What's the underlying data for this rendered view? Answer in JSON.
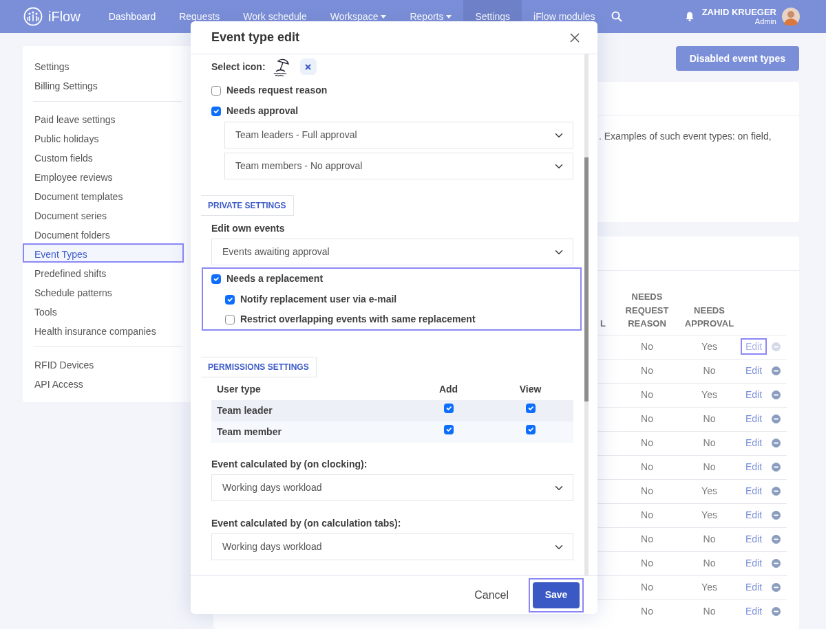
{
  "navbar": {
    "brand": "iFlow",
    "items": [
      {
        "label": "Dashboard",
        "selected": false,
        "dropdown": false
      },
      {
        "label": "Requests",
        "selected": false,
        "dropdown": false
      },
      {
        "label": "Work schedule",
        "selected": false,
        "dropdown": false
      },
      {
        "label": "Workspace",
        "selected": false,
        "dropdown": true
      },
      {
        "label": "Reports",
        "selected": false,
        "dropdown": true
      },
      {
        "label": "Settings",
        "selected": true,
        "dropdown": false
      },
      {
        "label": "iFlow modules",
        "selected": false,
        "dropdown": false
      }
    ],
    "user": {
      "name": "ZAHID KRUEGER",
      "role": "Admin"
    }
  },
  "sidebar": {
    "groups": [
      [
        {
          "label": "Settings",
          "selected": false
        },
        {
          "label": "Billing Settings",
          "selected": false
        }
      ],
      [
        {
          "label": "Paid leave settings",
          "selected": false
        },
        {
          "label": "Public holidays",
          "selected": false
        },
        {
          "label": "Custom fields",
          "selected": false
        },
        {
          "label": "Employee reviews",
          "selected": false
        },
        {
          "label": "Document templates",
          "selected": false
        },
        {
          "label": "Document series",
          "selected": false
        },
        {
          "label": "Document folders",
          "selected": false
        },
        {
          "label": "Event Types",
          "selected": true
        },
        {
          "label": "Predefined shifts",
          "selected": false
        },
        {
          "label": "Schedule patterns",
          "selected": false
        },
        {
          "label": "Tools",
          "selected": false
        },
        {
          "label": "Health insurance companies",
          "selected": false
        }
      ],
      [
        {
          "label": "RFID Devices",
          "selected": false
        },
        {
          "label": "API Access",
          "selected": false
        }
      ]
    ]
  },
  "disabled_button": "Disabled event types",
  "info_card": {
    "text": ". Examples of such event types: on field,"
  },
  "table": {
    "columns": [
      "L",
      "NEEDS REQUEST REASON",
      "NEEDS APPROVAL"
    ],
    "rows": [
      {
        "reason": "No",
        "approval": "Yes",
        "edit": "Edit",
        "highlighted": true,
        "remove_disabled": true
      },
      {
        "reason": "No",
        "approval": "No",
        "edit": "Edit",
        "highlighted": false,
        "remove_disabled": false
      },
      {
        "reason": "No",
        "approval": "Yes",
        "edit": "Edit",
        "highlighted": false,
        "remove_disabled": false
      },
      {
        "reason": "No",
        "approval": "No",
        "edit": "Edit",
        "highlighted": false,
        "remove_disabled": false
      },
      {
        "reason": "No",
        "approval": "No",
        "edit": "Edit",
        "highlighted": false,
        "remove_disabled": false
      },
      {
        "reason": "No",
        "approval": "No",
        "edit": "Edit",
        "highlighted": false,
        "remove_disabled": false
      },
      {
        "reason": "No",
        "approval": "Yes",
        "edit": "Edit",
        "highlighted": false,
        "remove_disabled": false
      },
      {
        "reason": "No",
        "approval": "Yes",
        "edit": "Edit",
        "highlighted": false,
        "remove_disabled": false
      },
      {
        "reason": "No",
        "approval": "No",
        "edit": "Edit",
        "highlighted": false,
        "remove_disabled": false
      },
      {
        "reason": "No",
        "approval": "No",
        "edit": "Edit",
        "highlighted": false,
        "remove_disabled": false
      },
      {
        "reason": "No",
        "approval": "Yes",
        "edit": "Edit",
        "highlighted": false,
        "remove_disabled": false
      },
      {
        "reason": "No",
        "approval": "No",
        "edit": "Edit",
        "highlighted": false,
        "remove_disabled": false
      }
    ]
  },
  "modal": {
    "title": "Event type edit",
    "select_icon_label": "Select icon:",
    "checks": [
      {
        "label": "Needs request reason",
        "checked": false
      },
      {
        "label": "Needs approval",
        "checked": true
      }
    ],
    "approval_selects": [
      "Team leaders - Full approval",
      "Team members - No approval"
    ],
    "private_tab": "PRIVATE SETTINGS",
    "edit_own_label": "Edit own events",
    "edit_own_value": "Events awaiting approval",
    "replacement": {
      "highlighted": true,
      "label": "Needs a replacement",
      "checked": true,
      "children": [
        {
          "label": "Notify replacement user via e-mail",
          "checked": true
        },
        {
          "label": "Restrict overlapping events with same replacement",
          "checked": false
        }
      ]
    },
    "permissions_tab": "PERMISSIONS SETTINGS",
    "permissions": {
      "columns": [
        "User type",
        "Add",
        "View"
      ],
      "rows": [
        {
          "user_type": "Team leader",
          "add": true,
          "view": true
        },
        {
          "user_type": "Team member",
          "add": true,
          "view": true
        }
      ]
    },
    "calc": [
      {
        "label": "Event calculated by (on clocking):",
        "value": "Working days workload"
      },
      {
        "label": "Event calculated by (on calculation tabs):",
        "value": "Working days workload"
      }
    ],
    "cancel": "Cancel",
    "save": {
      "label": "Save",
      "highlighted": true
    }
  }
}
